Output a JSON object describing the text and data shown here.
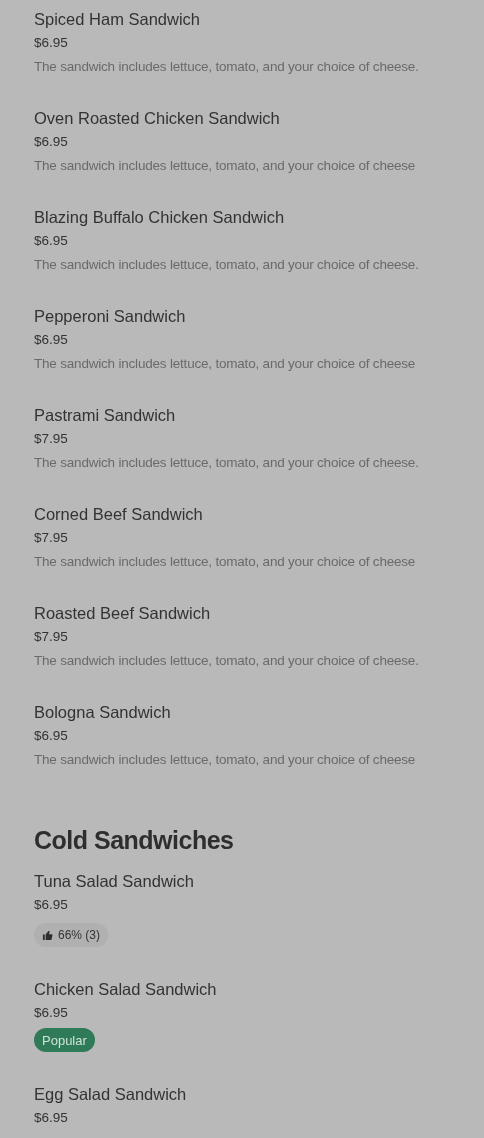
{
  "sections": [
    {
      "items": [
        {
          "name": "Spiced Ham Sandwich",
          "price": "$6.95",
          "description": "The sandwich includes lettuce, tomato, and your choice of cheese."
        },
        {
          "name": "Oven Roasted Chicken Sandwich",
          "price": "$6.95",
          "description": "The sandwich includes lettuce, tomato, and your choice of cheese"
        },
        {
          "name": "Blazing Buffalo Chicken Sandwich",
          "price": "$6.95",
          "description": "The sandwich includes lettuce, tomato, and your choice of cheese."
        },
        {
          "name": "Pepperoni Sandwich",
          "price": "$6.95",
          "description": "The sandwich includes lettuce, tomato, and your choice of cheese"
        },
        {
          "name": "Pastrami Sandwich",
          "price": "$7.95",
          "description": "The sandwich includes lettuce, tomato, and your choice of cheese."
        },
        {
          "name": "Corned Beef Sandwich",
          "price": "$7.95",
          "description": "The sandwich includes lettuce, tomato, and your choice of cheese"
        },
        {
          "name": "Roasted Beef Sandwich",
          "price": "$7.95",
          "description": "The sandwich includes lettuce, tomato, and your choice of cheese."
        },
        {
          "name": "Bologna Sandwich",
          "price": "$6.95",
          "description": "The sandwich includes lettuce, tomato, and your choice of cheese"
        }
      ]
    },
    {
      "title": "Cold Sandwiches",
      "items": [
        {
          "name": "Tuna Salad Sandwich",
          "price": "$6.95",
          "badge": {
            "kind": "rating",
            "text": "66% (3)"
          }
        },
        {
          "name": "Chicken Salad Sandwich",
          "price": "$6.95",
          "badge": {
            "kind": "popular",
            "text": "Popular"
          }
        },
        {
          "name": "Egg Salad Sandwich",
          "price": "$6.95"
        }
      ]
    }
  ]
}
